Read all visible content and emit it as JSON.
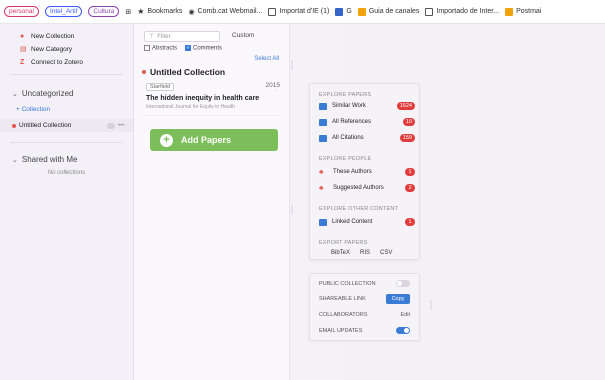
{
  "bookmarks": {
    "chips": [
      "personal",
      "Intel_Artif",
      "Cultura"
    ],
    "items": [
      "Bookmarks",
      "Comb.cat Webmail...",
      "Importat d'IE (1)",
      "G",
      "Guia de canales",
      "Importado de Inter...",
      "Postmai"
    ]
  },
  "sidebar": {
    "items": [
      {
        "label": "New Collection",
        "icon": "collection-icon"
      },
      {
        "label": "New Category",
        "icon": "category-icon"
      },
      {
        "label": "Connect to Zotero",
        "icon": "zotero-icon"
      }
    ],
    "group_uncategorized": "Uncategorized",
    "add_collection": "+ Collection",
    "selected_collection": "Untitled Collection",
    "group_shared": "Shared with Me",
    "no_collections": "No collections"
  },
  "middle": {
    "filter_placeholder": "Filter",
    "custom_label": "Custom",
    "abstracts_label": "Abstracts",
    "comments_label": "Comments",
    "select_all": "Select All",
    "collection_title": "Untitled Collection",
    "paper": {
      "source": "Starfield",
      "year": "2015",
      "title": "The hidden inequity in health care",
      "journal": "International Journal for Equity in Health"
    },
    "add_papers": "Add Papers"
  },
  "explore": {
    "papers_header": "EXPLORE PAPERS",
    "similar_work": {
      "label": "Similar Work",
      "count": "1624"
    },
    "all_references": {
      "label": "All References",
      "count": "10"
    },
    "all_citations": {
      "label": "All Citations",
      "count": "159"
    },
    "people_header": "EXPLORE PEOPLE",
    "these_authors": {
      "label": "These Authors",
      "count": "1"
    },
    "suggested_authors": {
      "label": "Suggested Authors",
      "count": "2"
    },
    "other_header": "EXPLORE OTHER CONTENT",
    "linked_content": {
      "label": "Linked Content",
      "count": "1"
    },
    "export_header": "EXPORT PAPERS",
    "formats": [
      "BibTeX",
      "RIS",
      "CSV"
    ]
  },
  "settings": {
    "public_collection": "PUBLIC COLLECTION",
    "public_on": false,
    "shareable_link": "SHAREABLE LINK",
    "copy": "Copy",
    "collaborators": "COLLABORATORS",
    "edit": "Edit",
    "email_updates": "EMAIL UPDATES",
    "email_on": true
  }
}
